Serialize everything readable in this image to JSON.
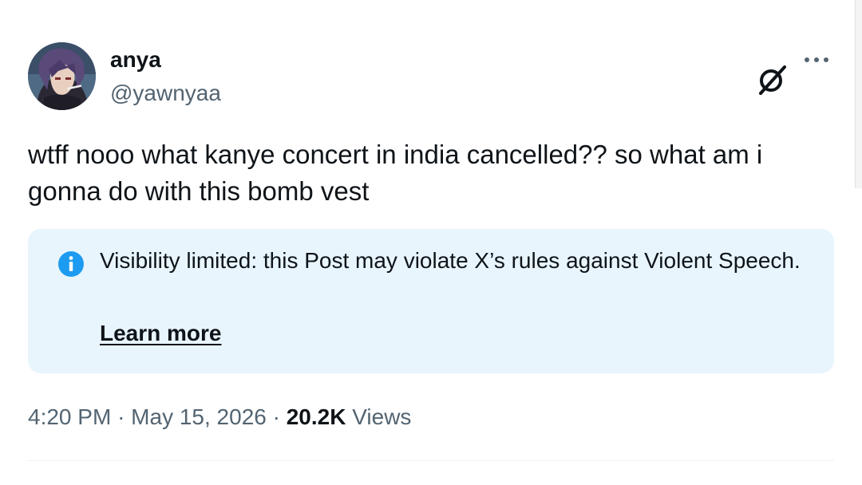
{
  "author": {
    "display_name": "anya",
    "handle": "@yawnyaa",
    "avatar_icon": "anime-character-avatar"
  },
  "actions": {
    "grok_icon": "grok-slash-circle-icon",
    "more_icon": "more-horizontal-icon"
  },
  "post": {
    "text": "wtff nooo what kanye concert in india cancelled?? so what am i gonna do with this bomb vest"
  },
  "notice": {
    "icon": "info-icon",
    "text": "Visibility limited: this Post may violate X’s rules against Violent Speech.",
    "link_label": "Learn more",
    "background": "#e8f5fd",
    "icon_color": "#1d9bf0"
  },
  "meta": {
    "time": "4:20 PM",
    "separator": "·",
    "date": "May 15, 2026",
    "views_count": "20.2K",
    "views_label": "Views"
  }
}
